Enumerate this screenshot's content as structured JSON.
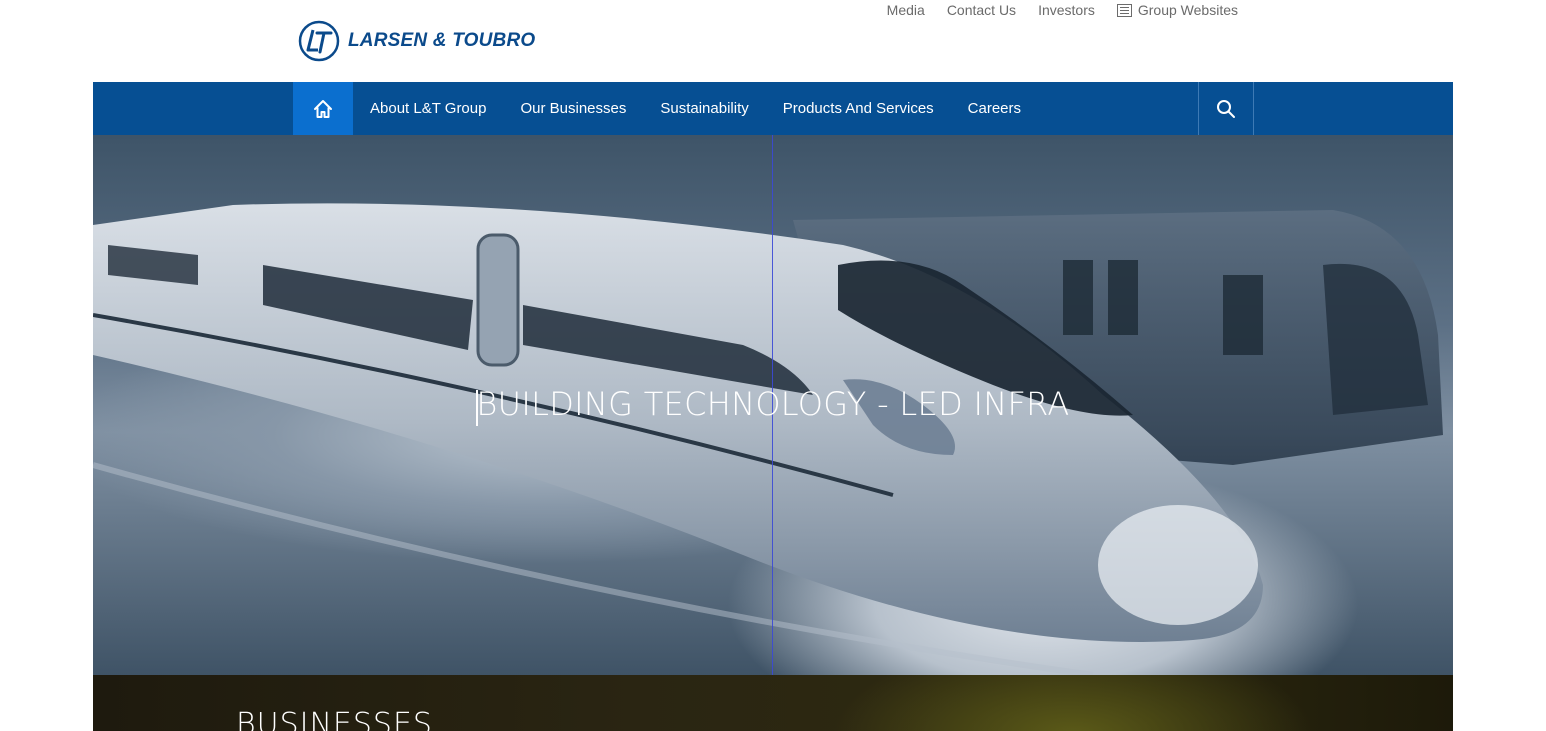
{
  "brand": {
    "name": "LARSEN & TOUBRO",
    "color": "#0b4a8b",
    "logo_icon": "lt-logo-icon"
  },
  "utility_nav": {
    "items": [
      {
        "label": "Media"
      },
      {
        "label": "Contact Us"
      },
      {
        "label": "Investors"
      }
    ],
    "group_websites": {
      "label": "Group Websites",
      "icon": "list-icon"
    }
  },
  "main_nav": {
    "background": "#064f93",
    "home_icon": "home-icon",
    "active_color": "#0b6fcf",
    "items": [
      {
        "label": "About L&T Group"
      },
      {
        "label": "Our Businesses"
      },
      {
        "label": "Sustainability"
      },
      {
        "label": "Products And Services"
      },
      {
        "label": "Careers"
      }
    ],
    "search_icon": "search-icon"
  },
  "hero": {
    "title": "BUILDING TECHNOLOGY - LED INFRA",
    "image": "high-speed-train-image"
  },
  "businesses": {
    "title": "BUSINESSES"
  }
}
